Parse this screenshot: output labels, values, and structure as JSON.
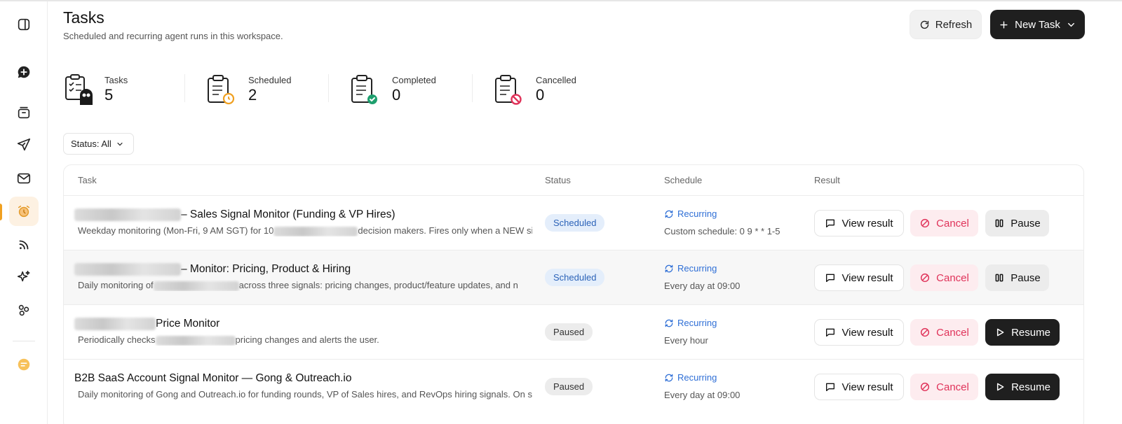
{
  "header": {
    "title": "Tasks",
    "subtitle": "Scheduled and recurring agent runs in this workspace.",
    "refresh_label": "Refresh",
    "new_task_label": "New Task"
  },
  "stats": [
    {
      "label": "Tasks",
      "value": "5"
    },
    {
      "label": "Scheduled",
      "value": "2"
    },
    {
      "label": "Completed",
      "value": "0"
    },
    {
      "label": "Cancelled",
      "value": "0"
    }
  ],
  "filter": {
    "label": "Status: All"
  },
  "table": {
    "columns": [
      "Task",
      "Status",
      "Schedule",
      "Result"
    ],
    "rows": [
      {
        "title": "– Sales Signal Monitor (Funding & VP Hires)",
        "desc_a": "Weekday monitoring (Mon-Fri, 9 AM SGT) for 10",
        "desc_b": "decision makers. Fires only when a NEW si",
        "status": "Scheduled",
        "schedule_type": "Recurring",
        "schedule_detail": "Custom schedule: 0 9 * * 1-5",
        "actions": {
          "view": "View result",
          "cancel": "Cancel",
          "toggle": "Pause"
        }
      },
      {
        "title": "– Monitor: Pricing, Product & Hiring",
        "desc_a": "Daily monitoring of",
        "desc_b": "across three signals: pricing changes, product/feature updates, and n",
        "status": "Scheduled",
        "schedule_type": "Recurring",
        "schedule_detail": "Every day at 09:00",
        "actions": {
          "view": "View result",
          "cancel": "Cancel",
          "toggle": "Pause"
        }
      },
      {
        "title": "Price Monitor",
        "desc_a": "Periodically checks",
        "desc_b": "pricing changes and alerts the user.",
        "status": "Paused",
        "schedule_type": "Recurring",
        "schedule_detail": "Every hour",
        "actions": {
          "view": "View result",
          "cancel": "Cancel",
          "toggle": "Resume"
        }
      },
      {
        "title": "B2B SaaS Account Signal Monitor — Gong & Outreach.io",
        "desc_a": "Daily monitoring of Gong and Outreach.io for funding rounds, VP of Sales hires, and RevOps hiring signals. On si",
        "desc_b": "",
        "status": "Paused",
        "schedule_type": "Recurring",
        "schedule_detail": "Every day at 09:00",
        "actions": {
          "view": "View result",
          "cancel": "Cancel",
          "toggle": "Resume"
        }
      }
    ]
  },
  "colors": {
    "accent_dark": "#1f1f1f",
    "scheduled_badge": "#e4eefb",
    "recurring_blue": "#2f6fd6",
    "cancel_red": "#e0335a",
    "sidebar_active": "#fdf1e2"
  },
  "icons": {
    "sidebar": [
      "sidebar-toggle-icon",
      "new-chat-icon",
      "inbox-icon",
      "send-icon",
      "mail-icon",
      "alarm-clock-icon",
      "rss-icon",
      "sparkles-icon",
      "integrations-icon",
      "chat-bubble-icon"
    ],
    "stats": [
      "clipboard-bot-icon",
      "clipboard-alarm-icon",
      "clipboard-check-icon",
      "clipboard-cancel-icon"
    ]
  }
}
